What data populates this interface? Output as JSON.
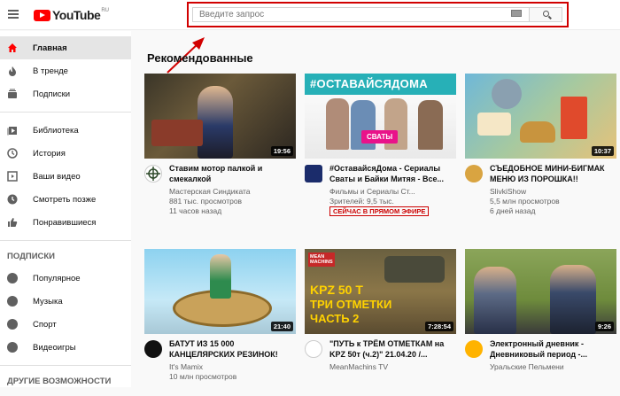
{
  "logo": {
    "text": "YouTube",
    "country": "RU"
  },
  "search": {
    "placeholder": "Введите запрос"
  },
  "sidebar": {
    "items": [
      {
        "label": "Главная",
        "icon": "home-icon"
      },
      {
        "label": "В тренде",
        "icon": "fire-icon"
      },
      {
        "label": "Подписки",
        "icon": "subscriptions-icon"
      },
      {
        "label": "Библиотека",
        "icon": "library-icon"
      },
      {
        "label": "История",
        "icon": "history-icon"
      },
      {
        "label": "Ваши видео",
        "icon": "your-videos-icon"
      },
      {
        "label": "Смотреть позже",
        "icon": "watch-later-icon"
      },
      {
        "label": "Понравившиеся",
        "icon": "like-icon"
      }
    ],
    "subs_title": "ПОДПИСКИ",
    "subs": [
      {
        "label": "Популярное"
      },
      {
        "label": "Музыка"
      },
      {
        "label": "Спорт"
      },
      {
        "label": "Видеоигры"
      }
    ],
    "more_title": "ДРУГИЕ ВОЗМОЖНОСТИ"
  },
  "main": {
    "heading": "Рекомендованные",
    "videos": [
      {
        "title": "Ставим мотор палкой и смекалкой",
        "channel": "Мастерская Синдиката",
        "views": "881 тыс. просмотров",
        "age": "11 часов назад",
        "duration": "19:56"
      },
      {
        "title": "#ОставайсяДома - Сериалы Сваты и Байки Митяя - Все...",
        "channel": "Фильмы и Сериалы Ст...",
        "views": "Зрителей: 9,5 тыс.",
        "live": "СЕЙЧАС В ПРЯМОМ ЭФИРЕ",
        "duration": "",
        "thumb_text": "#ОСТАВАЙСЯДОМА",
        "thumb_badge": "СВАТЫ"
      },
      {
        "title": "СЪЕДОБНОЕ МИНИ-БИГМАК МЕНЮ ИЗ ПОРОШКА!!",
        "channel": "SlivkiShow",
        "views": "5,5 млн просмотров",
        "age": "6 дней назад",
        "duration": "10:37"
      },
      {
        "title": "БАТУТ ИЗ 15 000 КАНЦЕЛЯРСКИХ РЕЗИНОК!",
        "channel": "It's Mamix",
        "views": "10 млн просмотров",
        "duration": "21:40"
      },
      {
        "title": "\"ПУТЬ к ТРЁМ ОТМЕТКАМ на KPZ 50т (ч.2)\" 21.04.20 /...",
        "channel": "MeanMachins TV",
        "views": "",
        "duration": "7:28:54",
        "thumb_line1": "KPZ 50 T",
        "thumb_line2": "ТРИ ОТМЕТКИ",
        "thumb_line3": "ЧАСТЬ 2",
        "thumb_logo": "MEAN MACHINS"
      },
      {
        "title": "Электронный дневник - Дневниковый период -...",
        "channel": "Уральские Пельмени",
        "views": "",
        "duration": "9:26"
      }
    ]
  },
  "colors": {
    "accent": "#ff0000",
    "highlight": "#d10000"
  }
}
